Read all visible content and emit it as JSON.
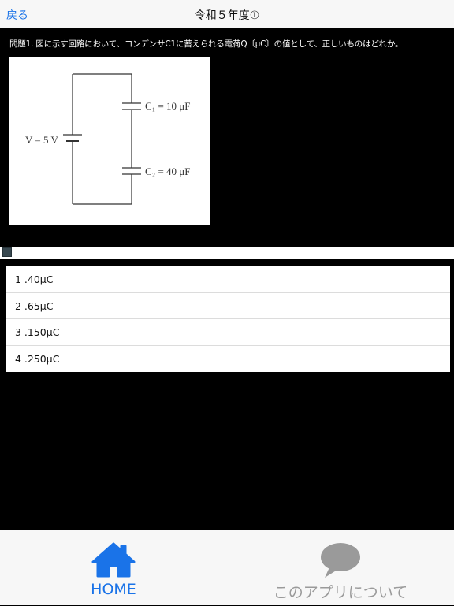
{
  "nav": {
    "back_label": "戻る",
    "title": "令和５年度①"
  },
  "question": {
    "text": "問題1. 図に示す回路において、コンデンサC1に蓄えられる電荷Q〔μC〕の値として、正しいものはどれか。",
    "figure": {
      "voltage_label": "V = 5 V",
      "c1_label": "C₁ = 10 μF",
      "c2_label": "C₂ = 40 μF"
    }
  },
  "answers": [
    {
      "label": "1 .40μC"
    },
    {
      "label": "2 .65μC"
    },
    {
      "label": "3 .150μC"
    },
    {
      "label": "4 .250μC"
    }
  ],
  "tabbar": {
    "home": {
      "label": "HOME",
      "icon": "home-icon",
      "color": "#1a73e8"
    },
    "about": {
      "label": "このアプリについて",
      "icon": "speech-bubble-icon",
      "color": "#9a9a9a"
    }
  }
}
